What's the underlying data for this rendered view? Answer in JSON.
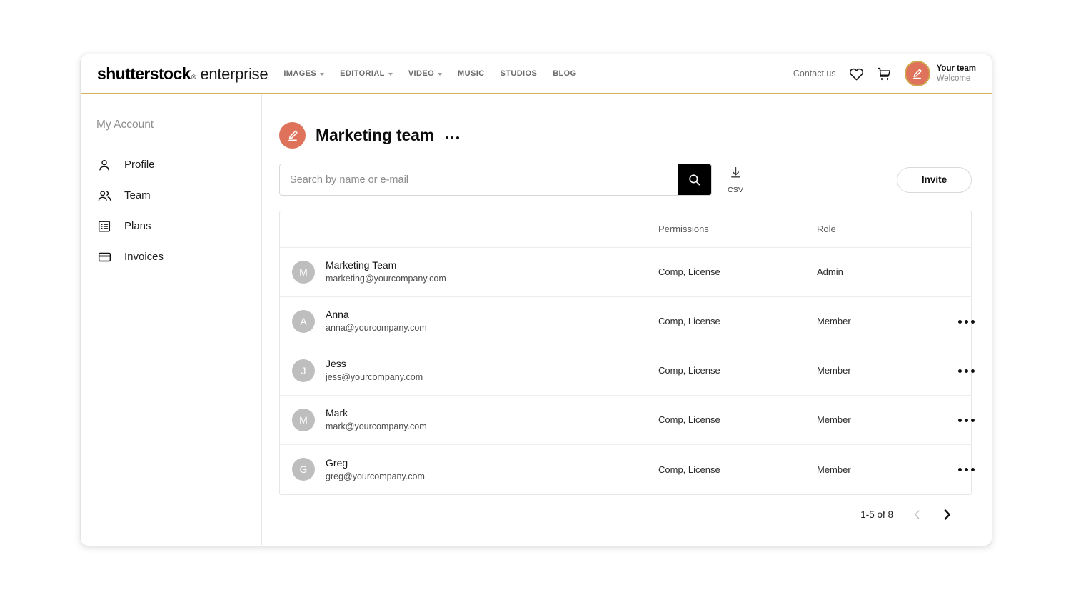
{
  "header": {
    "brand_bold": "shutterstock",
    "brand_mark": "®",
    "brand_light": "enterprise",
    "nav": [
      {
        "label": "IMAGES",
        "has_caret": true
      },
      {
        "label": "EDITORIAL",
        "has_caret": true
      },
      {
        "label": "VIDEO",
        "has_caret": true
      },
      {
        "label": "MUSIC",
        "has_caret": false
      },
      {
        "label": "STUDIOS",
        "has_caret": false
      },
      {
        "label": "BLOG",
        "has_caret": false
      }
    ],
    "contact_us": "Contact us",
    "heart_icon": "heart-icon",
    "cart_icon": "shopping-cart-icon",
    "avatar_icon": "pen-avatar-icon",
    "user_name": "Your team",
    "user_sub": "Welcome",
    "accent_line_color": "#d6b55a"
  },
  "sidebar": {
    "title": "My Account",
    "items": [
      {
        "label": "Profile",
        "icon": "user-icon"
      },
      {
        "label": "Team",
        "icon": "users-icon"
      },
      {
        "label": "Plans",
        "icon": "list-icon"
      },
      {
        "label": "Invoices",
        "icon": "credit-card-icon"
      }
    ]
  },
  "main": {
    "team_title": "Marketing team",
    "team_avatar_icon": "pen-avatar-icon",
    "title_menu_icon": "ellipsis-icon",
    "search": {
      "placeholder": "Search by name or e-mail",
      "value": "",
      "button_icon": "search-icon"
    },
    "csv": {
      "label": "CSV",
      "icon": "download-icon"
    },
    "invite_label": "Invite",
    "table": {
      "columns": [
        "",
        "Permissions",
        "Role",
        ""
      ],
      "rows": [
        {
          "initial": "M",
          "name": "Marketing Team",
          "email": "marketing@yourcompany.com",
          "permissions": "Comp, License",
          "role": "Admin",
          "has_actions": false
        },
        {
          "initial": "A",
          "name": "Anna",
          "email": "anna@yourcompany.com",
          "permissions": "Comp, License",
          "role": "Member",
          "has_actions": true
        },
        {
          "initial": "J",
          "name": "Jess",
          "email": "jess@yourcompany.com",
          "permissions": "Comp, License",
          "role": "Member",
          "has_actions": true
        },
        {
          "initial": "M",
          "name": "Mark",
          "email": "mark@yourcompany.com",
          "permissions": "Comp, License",
          "role": "Member",
          "has_actions": true
        },
        {
          "initial": "G",
          "name": "Greg",
          "email": "greg@yourcompany.com",
          "permissions": "Comp, License",
          "role": "Member",
          "has_actions": true
        }
      ]
    },
    "pagination": {
      "range": "1-5 of 8",
      "prev_icon": "chevron-left-icon",
      "next_icon": "chevron-right-icon",
      "prev_enabled": false,
      "next_enabled": true
    }
  },
  "colors": {
    "avatar_salmon": "#df725b",
    "avatar_ring_gold": "#cfa94e",
    "row_avatar_gray": "#bebebe",
    "accent_gold": "#d6b55a"
  }
}
